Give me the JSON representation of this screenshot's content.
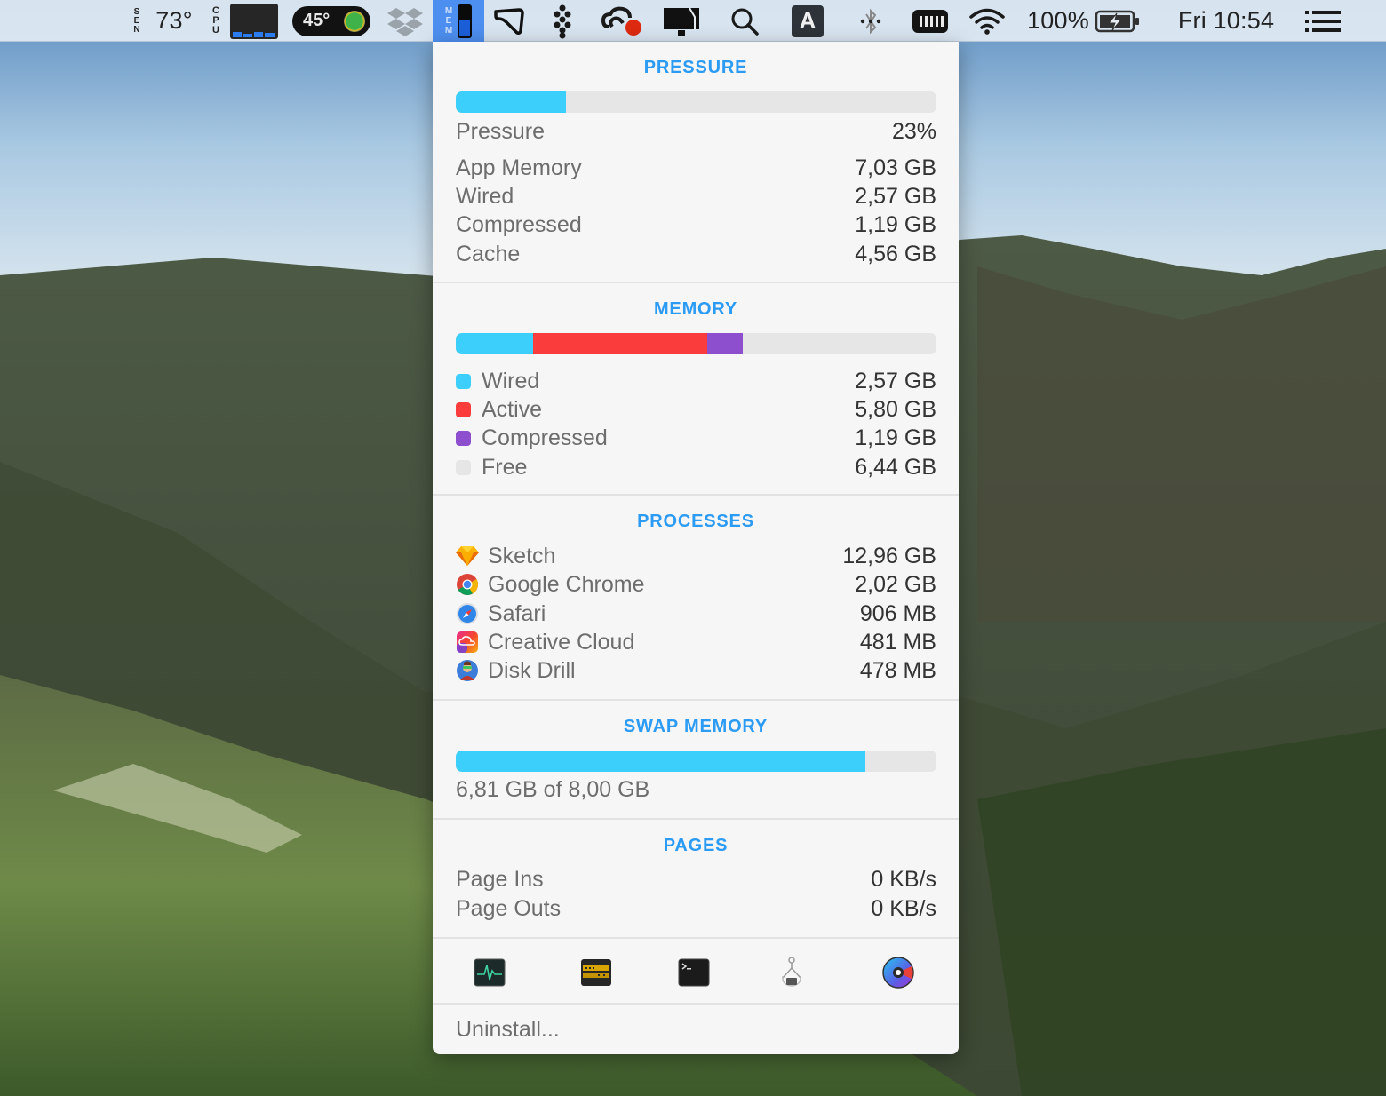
{
  "menubar": {
    "sensor_label": "SEN",
    "temperature": "73°",
    "cpu_label": "CPU",
    "gpu_temp": "45°",
    "mem_label": "MEM",
    "battery_percent": "100%",
    "clock": "Fri 10:54",
    "icons": [
      "sensor-icon",
      "cpu-graph-icon",
      "temp-badge-icon",
      "dropbox-icon",
      "memory-icon",
      "hand-icon",
      "flower-icon",
      "creative-cloud-icon",
      "display-icon",
      "spotlight-icon",
      "input-source-icon",
      "bluetooth-icon",
      "keyboard-battery-icon",
      "wifi-icon",
      "battery-icon",
      "notification-center-icon"
    ],
    "input_source_letter": "A"
  },
  "popover": {
    "pressure": {
      "title": "PRESSURE",
      "bar_percent": 23,
      "bar_color": "#3dcffb",
      "rows": [
        {
          "label": "Pressure",
          "value": "23%"
        },
        {
          "label": "App Memory",
          "value": "7,03 GB"
        },
        {
          "label": "Wired",
          "value": "2,57 GB"
        },
        {
          "label": "Compressed",
          "value": "1,19 GB"
        },
        {
          "label": "Cache",
          "value": "4,56 GB"
        }
      ]
    },
    "memory": {
      "title": "MEMORY",
      "segments": [
        {
          "label": "Wired",
          "value": "2,57 GB",
          "gb": 2.57,
          "color": "#3dcffb"
        },
        {
          "label": "Active",
          "value": "5,80 GB",
          "gb": 5.8,
          "color": "#fb3c3c"
        },
        {
          "label": "Compressed",
          "value": "1,19 GB",
          "gb": 1.19,
          "color": "#8e4fcf"
        },
        {
          "label": "Free",
          "value": "6,44 GB",
          "gb": 6.44,
          "color": "#e6e6e6"
        }
      ]
    },
    "processes": {
      "title": "PROCESSES",
      "items": [
        {
          "name": "Sketch",
          "value": "12,96 GB",
          "icon": "sketch-icon"
        },
        {
          "name": "Google Chrome",
          "value": "2,02 GB",
          "icon": "chrome-icon"
        },
        {
          "name": "Safari",
          "value": "906 MB",
          "icon": "safari-icon"
        },
        {
          "name": "Creative Cloud",
          "value": "481 MB",
          "icon": "creative-cloud-icon"
        },
        {
          "name": "Disk Drill",
          "value": "478 MB",
          "icon": "disk-drill-icon"
        }
      ]
    },
    "swap": {
      "title": "SWAP MEMORY",
      "used_gb": 6.81,
      "total_gb": 8.0,
      "bar_color": "#3dcffb",
      "summary": "6,81 GB of 8,00 GB"
    },
    "pages": {
      "title": "PAGES",
      "rows": [
        {
          "label": "Page Ins",
          "value": "0 KB/s"
        },
        {
          "label": "Page Outs",
          "value": "0 KB/s"
        }
      ]
    },
    "tools": [
      "activity-monitor-icon",
      "console-icon",
      "terminal-icon",
      "system-information-icon",
      "istat-menus-icon"
    ],
    "uninstall_label": "Uninstall..."
  }
}
